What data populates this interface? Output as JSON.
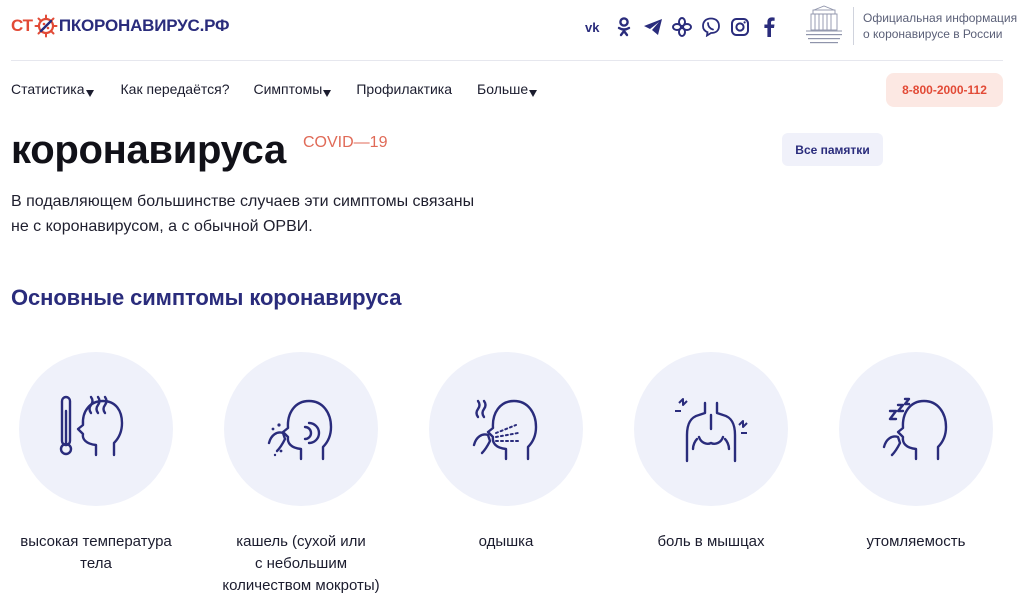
{
  "header": {
    "logo": {
      "part1": "СТ",
      "part2": "ПКОРОНАВИРУС.РФ"
    },
    "socials": [
      "vk-icon",
      "odnoklassniki-icon",
      "telegram-icon",
      "flower-icon",
      "viber-icon",
      "instagram-icon",
      "facebook-icon"
    ],
    "gov_info": {
      "line1": "Официальная информация",
      "line2": "о коронавирусе в России"
    }
  },
  "nav": {
    "items": [
      {
        "label": "Статистика",
        "has_dropdown": true
      },
      {
        "label": "Как передаётся?",
        "has_dropdown": false
      },
      {
        "label": "Симптомы",
        "has_dropdown": true
      },
      {
        "label": "Профилактика",
        "has_dropdown": false
      },
      {
        "label": "Больше",
        "has_dropdown": true
      }
    ],
    "hotline": "8-800-2000-112"
  },
  "hero": {
    "title": "коронавируса",
    "badge": "COVID—19",
    "all_memos": "Все памятки",
    "subtitle_line1": "В подавляющем большинстве случаев эти симптомы связаны",
    "subtitle_line2": "не с коронавирусом, а с обычной ОРВИ."
  },
  "section": {
    "title": "Основные симптомы коронавируса"
  },
  "symptoms": [
    {
      "icon": "thermometer-head-icon",
      "line1": "высокая температура",
      "line2": "тела",
      "line3": ""
    },
    {
      "icon": "cough-icon",
      "line1": "кашель (сухой или",
      "line2": "с небольшим",
      "line3": "количеством мокроты)"
    },
    {
      "icon": "shortness-of-breath-icon",
      "line1": "одышка",
      "line2": "",
      "line3": ""
    },
    {
      "icon": "muscle-pain-icon",
      "line1": "боль в мышцах",
      "line2": "",
      "line3": ""
    },
    {
      "icon": "fatigue-icon",
      "line1": "утомляемость",
      "line2": "",
      "line3": ""
    }
  ],
  "colors": {
    "brand_blue": "#2a2c7c",
    "brand_red": "#e24a36",
    "card_bg": "#eff1fa"
  }
}
